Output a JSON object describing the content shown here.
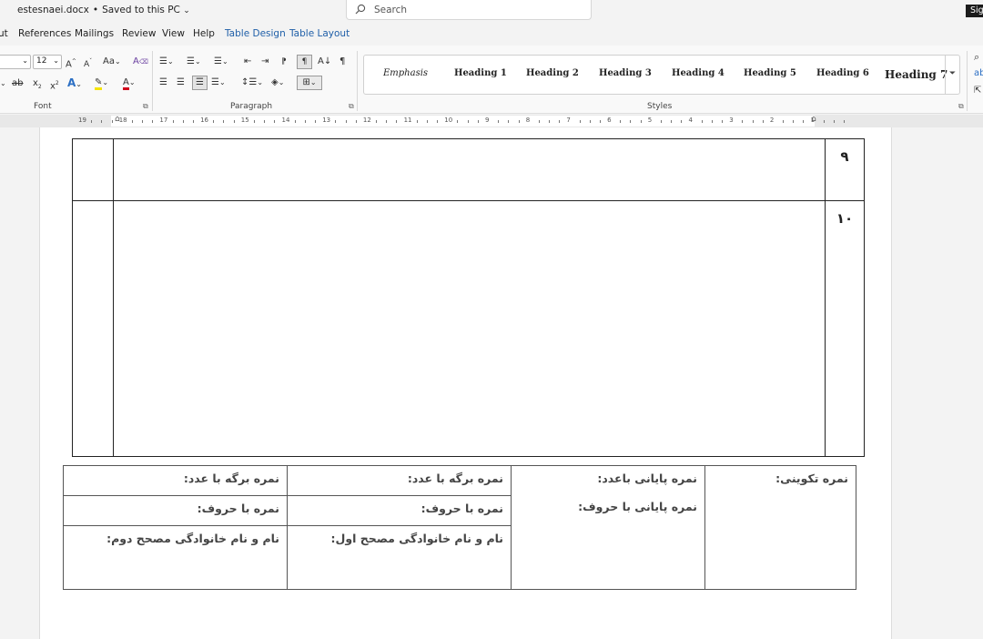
{
  "window": {
    "file_name": "estesnaei.docx",
    "save_status": "Saved to this PC",
    "search_placeholder": "Search",
    "signin_label": "Sig"
  },
  "ribbon_tabs": [
    "ut",
    "References",
    "Mailings",
    "Review",
    "View",
    "Help",
    "Table Design",
    "Table Layout"
  ],
  "ribbon": {
    "font": {
      "font_size": "12",
      "group_label": "Font"
    },
    "paragraph": {
      "group_label": "Paragraph"
    },
    "styles": {
      "group_label": "Styles",
      "items": [
        "Emphasis",
        "Heading 1",
        "Heading 2",
        "Heading 3",
        "Heading 4",
        "Heading 5",
        "Heading 6",
        "Heading 7"
      ]
    }
  },
  "ruler": {
    "numbers": [
      "19",
      "18",
      "17",
      "16",
      "15",
      "14",
      "13",
      "12",
      "11",
      "10",
      "9",
      "8",
      "7",
      "6",
      "5",
      "4",
      "3",
      "2",
      "1"
    ]
  },
  "document": {
    "answer_rows": [
      {
        "number": "۹"
      },
      {
        "number": "۱۰"
      }
    ],
    "grade_table": {
      "formative_score": "نمره تکوینی:",
      "final_score_number": "نمره پایانی باعدد:",
      "final_score_letters": "نمره پایانی با حروف:",
      "sheet_score_number_1": "نمره برگه با عدد:",
      "score_letters_1": "نمره با حروف:",
      "first_grader_name": "نام و نام خانوادگی مصحح اول:",
      "sheet_score_number_2": "نمره برگه با عدد:",
      "score_letters_2": "نمره با حروف:",
      "second_grader_name": "نام و نام خانوادگی مصحح دوم:"
    }
  }
}
